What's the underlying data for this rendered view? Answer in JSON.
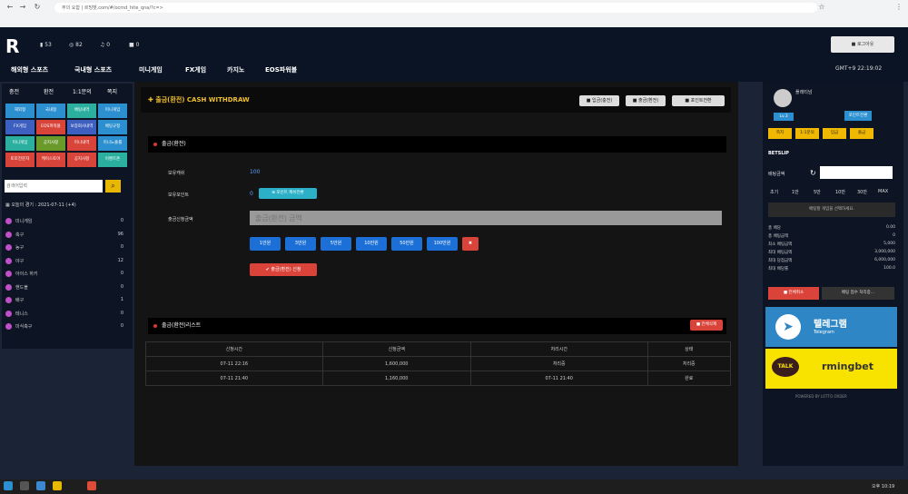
{
  "browser": {
    "url": "주의 요함 | 르밍벳.com/#/ocmd_hite_qna/?c=>"
  },
  "header": {
    "stats": [
      {
        "icon": "wallet-icon",
        "value": "53"
      },
      {
        "icon": "coin-icon",
        "value": "82"
      },
      {
        "icon": "message-icon",
        "value": "0"
      },
      {
        "icon": "mail-icon",
        "value": "0"
      }
    ],
    "menu": [
      "해외형 스포츠",
      "국내형 스포츠",
      "미니게임",
      "FX게임",
      "카지노",
      "EOS파워볼"
    ],
    "login_button": "■ 로그아웃",
    "clock": "GMT+9 22:19:02"
  },
  "left": {
    "tabs": [
      "충전",
      "환전",
      "1:1문의",
      "쪽지"
    ],
    "games": [
      {
        "label": "해외형",
        "color": "#2b8fd0"
      },
      {
        "label": "국내형",
        "color": "#2b8fd0"
      },
      {
        "label": "배팅내역",
        "color": "#2bb0a0"
      },
      {
        "label": "미니게임",
        "color": "#2b8fd0"
      },
      {
        "label": "FX게임",
        "color": "#3d5fc0"
      },
      {
        "label": "EOS파워볼",
        "color": "#d8433a"
      },
      {
        "label": "보증회사내역",
        "color": "#3d5fc0"
      },
      {
        "label": "배팅규정",
        "color": "#2b8fd0"
      },
      {
        "label": "미니게임",
        "color": "#2bb0a0"
      },
      {
        "label": "공지사항",
        "color": "#6a9a2a"
      },
      {
        "label": "미니내역",
        "color": "#d8433a"
      },
      {
        "label": "미니노출률",
        "color": "#2b8fd0"
      },
      {
        "label": "토토전문자",
        "color": "#d8433a"
      },
      {
        "label": "케이스토어",
        "color": "#d8433a"
      },
      {
        "label": "공지사항",
        "color": "#d8433a"
      },
      {
        "label": "이벤트존",
        "color": "#2bb0a0"
      }
    ],
    "search_placeholder": "검색어입력",
    "time_text": "오늘의 경기 : 2021-07-11 (+4)",
    "game_list": [
      {
        "name": "미니게임",
        "count": "0"
      },
      {
        "name": "축구",
        "count": "96"
      },
      {
        "name": "농구",
        "count": "0"
      },
      {
        "name": "야구",
        "count": "12"
      },
      {
        "name": "아이스 하키",
        "count": "0"
      },
      {
        "name": "핸드볼",
        "count": "0"
      },
      {
        "name": "배구",
        "count": "1"
      },
      {
        "name": "테니스",
        "count": "0"
      },
      {
        "name": "미식축구",
        "count": "0"
      }
    ]
  },
  "main": {
    "title": "✚ 출금(환전) CASH WITHDRAW",
    "top_buttons": [
      "■ 입금(충전)",
      "■ 출금(환전)",
      "■ 포인트전환"
    ],
    "section1": "출금(환전)",
    "rows": [
      {
        "label": "보유캐쉬",
        "value": "100"
      },
      {
        "label": "보유포인트",
        "value": "0"
      },
      {
        "label": "출금신청금액"
      }
    ],
    "point_button": "⊕ 포인트 캐쉬전환",
    "amount_placeholder": "출금(환전) 금액",
    "amount_buttons": [
      "1만원",
      "3만원",
      "5만원",
      "10만원",
      "50만원",
      "100만원"
    ],
    "clear_icon": "trash-icon",
    "submit": "✔ 출금(환전) 신청",
    "section2": "출금(환전)리스트",
    "delete_all": "■ 전체삭제",
    "table": {
      "headers": [
        "신청시간",
        "신청금액",
        "처리시간",
        "상태"
      ],
      "rows": [
        [
          "07-11 22:16",
          "1,600,000",
          "처리중",
          "처리중"
        ],
        [
          "07-11 21:40",
          "1,160,000",
          "07-11 21:40",
          "완료"
        ]
      ]
    }
  },
  "right": {
    "user_level": "Lv.3",
    "user_name": "플래티넘",
    "user_btn": "포인트전환",
    "quick_buttons": [
      "쪽지",
      "1:1문의",
      "입금",
      "출금"
    ],
    "betslip_title": "BETSLIP",
    "bet_amount_label": "배팅금액",
    "chips": [
      "초기",
      "1만",
      "5만",
      "10만",
      "30만",
      "MAX"
    ],
    "empty_msg": "배팅할 게임을 선택하세요.",
    "stats": [
      {
        "label": "총 배당",
        "value": "0.00"
      },
      {
        "label": "총 배팅금액",
        "value": "0"
      },
      {
        "label": "최소 배팅금액",
        "value": "5,000"
      },
      {
        "label": "최대 배팅금액",
        "value": "3,000,000"
      },
      {
        "label": "최대 당첨금액",
        "value": "6,000,000"
      },
      {
        "label": "최대 배당률",
        "value": "100.0"
      }
    ],
    "reset_btn": "■ 전체취소",
    "bet_btn": "배팅 접수 처리중...",
    "telegram": {
      "title": "텔레그램",
      "sub": "Telegram"
    },
    "kakao": {
      "talk": "TALK",
      "name": "rmingbet"
    },
    "footer": "POWERED BY LOTTO ORDER"
  },
  "taskbar": {
    "time": "오후 10:19"
  }
}
